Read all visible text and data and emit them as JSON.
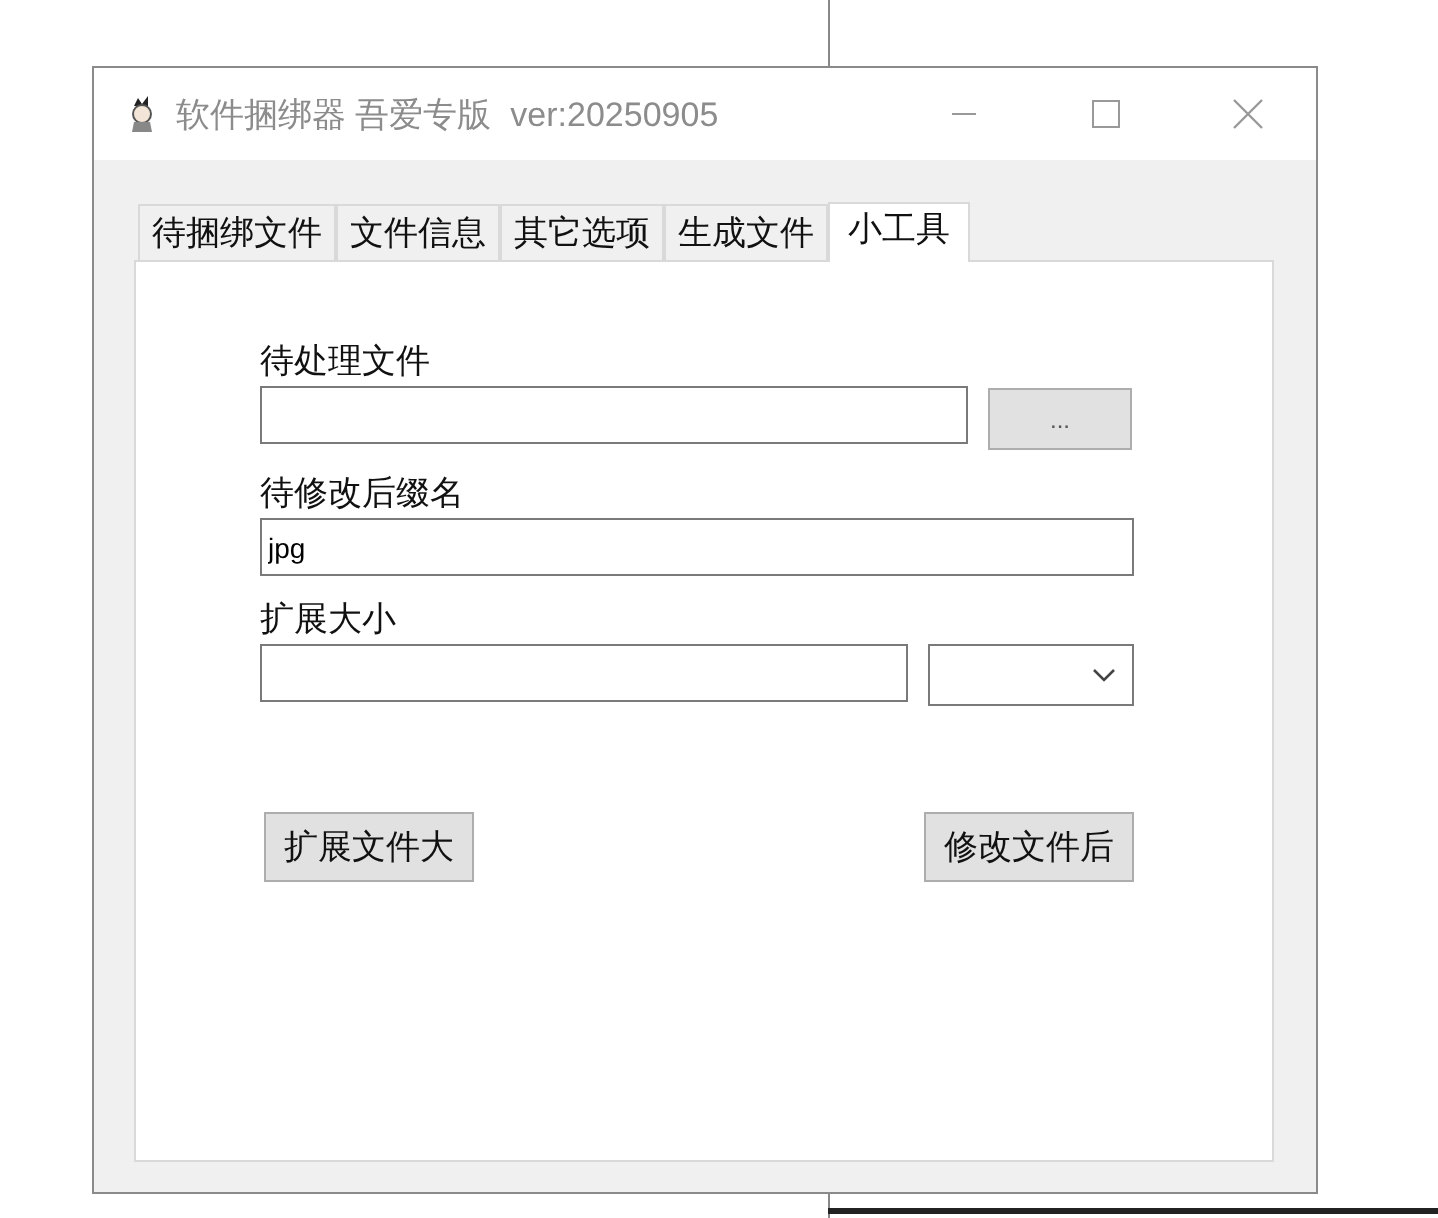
{
  "window": {
    "title": "软件捆绑器 吾爱专版  ver:20250905"
  },
  "tabs": [
    {
      "label": "待捆绑文件",
      "selected": false
    },
    {
      "label": "文件信息",
      "selected": false
    },
    {
      "label": "其它选项",
      "selected": false
    },
    {
      "label": "生成文件",
      "selected": false
    },
    {
      "label": "小工具",
      "selected": true
    }
  ],
  "sections": [
    {
      "kind": "browse",
      "label": "待处理文件",
      "button": "..."
    },
    {
      "kind": "text",
      "label": "待修改后缀名",
      "value": "jpg"
    },
    {
      "kind": "combo",
      "label": "扩展大小"
    }
  ],
  "buttons": [
    "扩展文件大",
    "修改文件后"
  ]
}
